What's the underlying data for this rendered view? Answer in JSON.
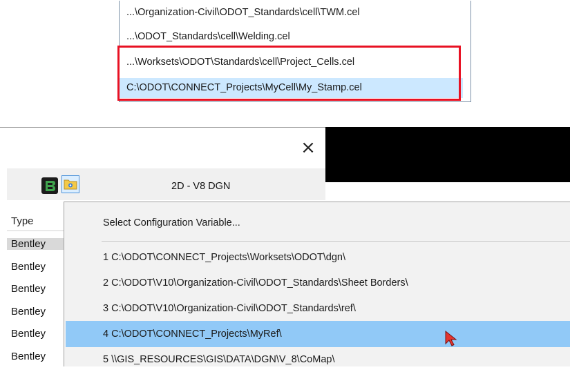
{
  "cell_library_list": {
    "items": [
      "...\\Organization-Civil\\ODOT_Standards\\cell\\TWM.cel",
      "...\\ODOT_Standards\\cell\\Welding.cel",
      "...\\Worksets\\ODOT\\Standards\\cell\\Project_Cells.cel",
      "C:\\ODOT\\CONNECT_Projects\\MyCell\\My_Stamp.cel"
    ],
    "selected_index": 3,
    "highlight_color": "#e81123"
  },
  "dialog": {
    "close_label": "×",
    "file_type": "2D - V8 DGN",
    "icons": [
      "bentley-app-icon",
      "config-folder-icon",
      "close-icon"
    ]
  },
  "file_list": {
    "header": "Type",
    "rows": [
      "Bentley",
      "Bentley",
      "Bentley",
      "Bentley",
      "Bentley",
      "Bentley"
    ]
  },
  "menu": {
    "header_item": "Select Configuration Variable...",
    "items": [
      "1 C:\\ODOT\\CONNECT_Projects\\Worksets\\ODOT\\dgn\\",
      "2 C:\\ODOT\\V10\\Organization-Civil\\ODOT_Standards\\Sheet Borders\\",
      "3 C:\\ODOT\\V10\\Organization-Civil\\ODOT_Standards\\ref\\",
      "4 C:\\ODOT\\CONNECT_Projects\\MyRef\\",
      "5 \\\\GIS_RESOURCES\\GIS\\DATA\\DGN\\V_8\\CoMap\\"
    ],
    "highlighted_index": 3,
    "highlight_color": "#91c9f7"
  }
}
